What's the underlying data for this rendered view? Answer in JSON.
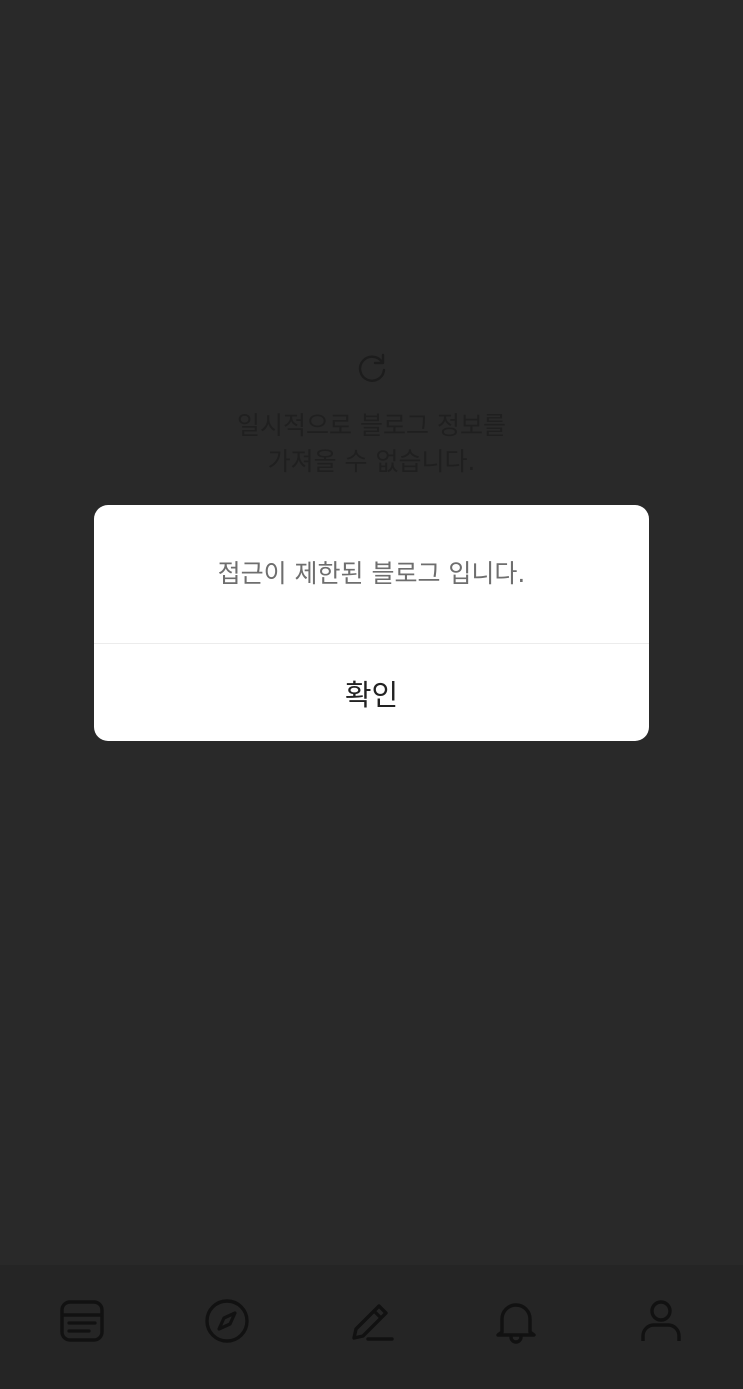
{
  "background": {
    "error_message": "일시적으로 블로그 정보를\n가져올 수 없습니다.",
    "reload_icon": "reload-icon"
  },
  "dialog": {
    "message": "접근이 제한된 블로그 입니다.",
    "confirm_label": "확인"
  },
  "bottom_nav": {
    "items": [
      {
        "icon": "feed-icon"
      },
      {
        "icon": "compass-icon"
      },
      {
        "icon": "pencil-icon"
      },
      {
        "icon": "bell-icon"
      },
      {
        "icon": "person-icon"
      }
    ]
  },
  "colors": {
    "backdrop": "#292929",
    "dialog_bg": "#ffffff",
    "icon_stroke": "#111111"
  }
}
